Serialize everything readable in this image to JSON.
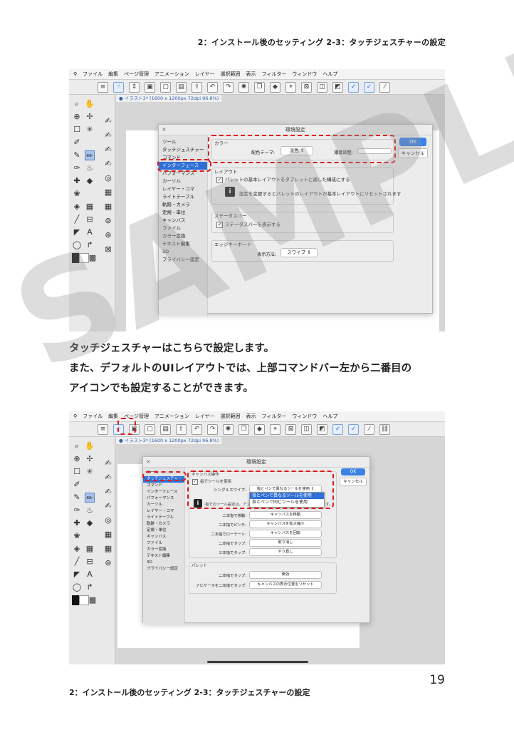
{
  "header": "2：インストール後のセッティング 2-3：タッチジェスチャーの設定",
  "footer": "2：インストール後のセッティング 2-3：タッチジェスチャーの設定",
  "page_number": "19",
  "watermark": "SAMPLE",
  "body": {
    "line1": "タッチジェスチャーはこちらで設定します。",
    "line2_pre": "また、デフォルトのUIレイアウトでは、",
    "line2_bold": "上部コマンドバー左から二番目の",
    "line3_bold": "アイコン",
    "line3_post": "でも設定することができます。"
  },
  "app": {
    "menu": [
      "ファイル",
      "編集",
      "ページ管理",
      "アニメーション",
      "レイヤー",
      "選択範囲",
      "表示",
      "フィルター",
      "ウィンドウ",
      "ヘルプ"
    ],
    "doc_tab": "● イラスト3* (1600 x 1200px 72dpi 96.8%)",
    "dialog_title": "環境設定",
    "ok": "OK",
    "cancel": "キャンセル",
    "categories": [
      "ツール",
      "タッチジェスチャー",
      "コマンド",
      "インターフェース",
      "パフォーマンス",
      "カーソル",
      "レイヤー・コマ",
      "ライトテーブル",
      "軌跡・カメラ",
      "定規・単位",
      "キャンバス",
      "ファイル",
      "カラー変換",
      "テキスト編集",
      "3D",
      "プライバシー設定"
    ]
  },
  "shot1": {
    "color_group": "カラー",
    "color_theme_label": "配色テーマ:",
    "color_theme_value": "淡色",
    "density_label": "濃度調整:",
    "layout_group": "レイアウト",
    "layout_check": "パレットの基本レイアウトをタブレットに適した構成にする",
    "layout_info": "設定を変更するとパレットのレイアウトが基本レイアウトにリセットされます",
    "statusbar_group": "ステータスバー",
    "statusbar_check": "ステータスバーを表示する",
    "edge_group": "エッジキーボード",
    "display_method_label": "表示方法:",
    "display_method_value": "スワイプ"
  },
  "shot2": {
    "canvas_group": "キャンバス操作",
    "finger_tool_check": "指でツールを使用",
    "single_swipe_label": "シングルスワイプ:",
    "single_swipe_value": "指とペンで異なるツールを使用",
    "popup_options": [
      "指とペンで異なるツールを使用",
      "指とペンで同じツールを使用"
    ],
    "info_text": "指でのツール設定は、アプリ",
    "info_tail": "ます。",
    "rows": [
      {
        "label": "二本指で移動:",
        "value": "キャンバスを移動"
      },
      {
        "label": "二本指でピンチ:",
        "value": "キャンバスを拡大縮小"
      },
      {
        "label": "二本指でローテート:",
        "value": "キャンバスを回転"
      },
      {
        "label": "二本指でタップ:",
        "value": "取り消し"
      },
      {
        "label": "三本指でタップ:",
        "value": "やり直し"
      }
    ],
    "palette_group": "パレット",
    "palette_rows": [
      {
        "label": "二本指でタップ:",
        "value": "無効"
      },
      {
        "label": "ナビゲータを二本指でタップ:",
        "value": "キャンバスの表示位置をリセット"
      }
    ]
  },
  "colors": {
    "accent": "#2f6fd6",
    "highlight": "#d81e1e"
  }
}
